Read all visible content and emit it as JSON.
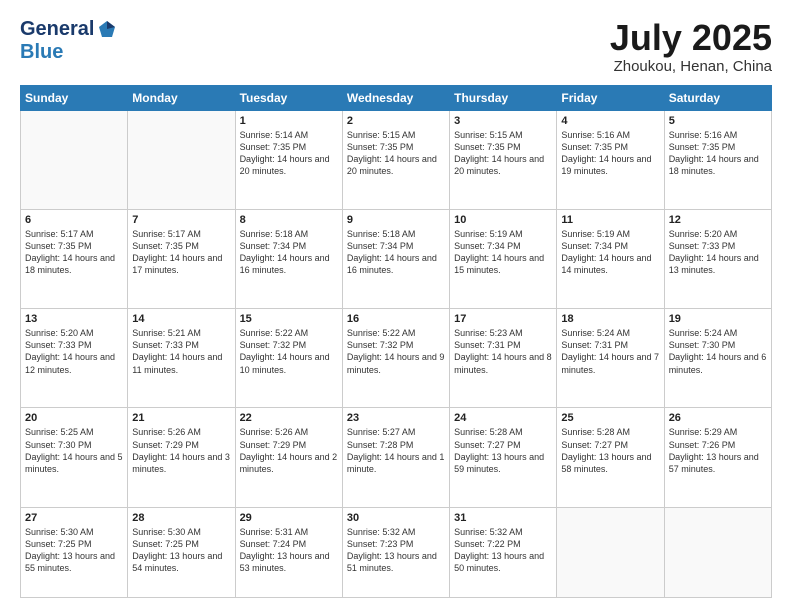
{
  "logo": {
    "general": "General",
    "blue": "Blue"
  },
  "header": {
    "month": "July 2025",
    "location": "Zhoukou, Henan, China"
  },
  "weekdays": [
    "Sunday",
    "Monday",
    "Tuesday",
    "Wednesday",
    "Thursday",
    "Friday",
    "Saturday"
  ],
  "weeks": [
    [
      {
        "day": "",
        "info": ""
      },
      {
        "day": "",
        "info": ""
      },
      {
        "day": "1",
        "info": "Sunrise: 5:14 AM\nSunset: 7:35 PM\nDaylight: 14 hours and 20 minutes."
      },
      {
        "day": "2",
        "info": "Sunrise: 5:15 AM\nSunset: 7:35 PM\nDaylight: 14 hours and 20 minutes."
      },
      {
        "day": "3",
        "info": "Sunrise: 5:15 AM\nSunset: 7:35 PM\nDaylight: 14 hours and 20 minutes."
      },
      {
        "day": "4",
        "info": "Sunrise: 5:16 AM\nSunset: 7:35 PM\nDaylight: 14 hours and 19 minutes."
      },
      {
        "day": "5",
        "info": "Sunrise: 5:16 AM\nSunset: 7:35 PM\nDaylight: 14 hours and 18 minutes."
      }
    ],
    [
      {
        "day": "6",
        "info": "Sunrise: 5:17 AM\nSunset: 7:35 PM\nDaylight: 14 hours and 18 minutes."
      },
      {
        "day": "7",
        "info": "Sunrise: 5:17 AM\nSunset: 7:35 PM\nDaylight: 14 hours and 17 minutes."
      },
      {
        "day": "8",
        "info": "Sunrise: 5:18 AM\nSunset: 7:34 PM\nDaylight: 14 hours and 16 minutes."
      },
      {
        "day": "9",
        "info": "Sunrise: 5:18 AM\nSunset: 7:34 PM\nDaylight: 14 hours and 16 minutes."
      },
      {
        "day": "10",
        "info": "Sunrise: 5:19 AM\nSunset: 7:34 PM\nDaylight: 14 hours and 15 minutes."
      },
      {
        "day": "11",
        "info": "Sunrise: 5:19 AM\nSunset: 7:34 PM\nDaylight: 14 hours and 14 minutes."
      },
      {
        "day": "12",
        "info": "Sunrise: 5:20 AM\nSunset: 7:33 PM\nDaylight: 14 hours and 13 minutes."
      }
    ],
    [
      {
        "day": "13",
        "info": "Sunrise: 5:20 AM\nSunset: 7:33 PM\nDaylight: 14 hours and 12 minutes."
      },
      {
        "day": "14",
        "info": "Sunrise: 5:21 AM\nSunset: 7:33 PM\nDaylight: 14 hours and 11 minutes."
      },
      {
        "day": "15",
        "info": "Sunrise: 5:22 AM\nSunset: 7:32 PM\nDaylight: 14 hours and 10 minutes."
      },
      {
        "day": "16",
        "info": "Sunrise: 5:22 AM\nSunset: 7:32 PM\nDaylight: 14 hours and 9 minutes."
      },
      {
        "day": "17",
        "info": "Sunrise: 5:23 AM\nSunset: 7:31 PM\nDaylight: 14 hours and 8 minutes."
      },
      {
        "day": "18",
        "info": "Sunrise: 5:24 AM\nSunset: 7:31 PM\nDaylight: 14 hours and 7 minutes."
      },
      {
        "day": "19",
        "info": "Sunrise: 5:24 AM\nSunset: 7:30 PM\nDaylight: 14 hours and 6 minutes."
      }
    ],
    [
      {
        "day": "20",
        "info": "Sunrise: 5:25 AM\nSunset: 7:30 PM\nDaylight: 14 hours and 5 minutes."
      },
      {
        "day": "21",
        "info": "Sunrise: 5:26 AM\nSunset: 7:29 PM\nDaylight: 14 hours and 3 minutes."
      },
      {
        "day": "22",
        "info": "Sunrise: 5:26 AM\nSunset: 7:29 PM\nDaylight: 14 hours and 2 minutes."
      },
      {
        "day": "23",
        "info": "Sunrise: 5:27 AM\nSunset: 7:28 PM\nDaylight: 14 hours and 1 minute."
      },
      {
        "day": "24",
        "info": "Sunrise: 5:28 AM\nSunset: 7:27 PM\nDaylight: 13 hours and 59 minutes."
      },
      {
        "day": "25",
        "info": "Sunrise: 5:28 AM\nSunset: 7:27 PM\nDaylight: 13 hours and 58 minutes."
      },
      {
        "day": "26",
        "info": "Sunrise: 5:29 AM\nSunset: 7:26 PM\nDaylight: 13 hours and 57 minutes."
      }
    ],
    [
      {
        "day": "27",
        "info": "Sunrise: 5:30 AM\nSunset: 7:25 PM\nDaylight: 13 hours and 55 minutes."
      },
      {
        "day": "28",
        "info": "Sunrise: 5:30 AM\nSunset: 7:25 PM\nDaylight: 13 hours and 54 minutes."
      },
      {
        "day": "29",
        "info": "Sunrise: 5:31 AM\nSunset: 7:24 PM\nDaylight: 13 hours and 53 minutes."
      },
      {
        "day": "30",
        "info": "Sunrise: 5:32 AM\nSunset: 7:23 PM\nDaylight: 13 hours and 51 minutes."
      },
      {
        "day": "31",
        "info": "Sunrise: 5:32 AM\nSunset: 7:22 PM\nDaylight: 13 hours and 50 minutes."
      },
      {
        "day": "",
        "info": ""
      },
      {
        "day": "",
        "info": ""
      }
    ]
  ]
}
